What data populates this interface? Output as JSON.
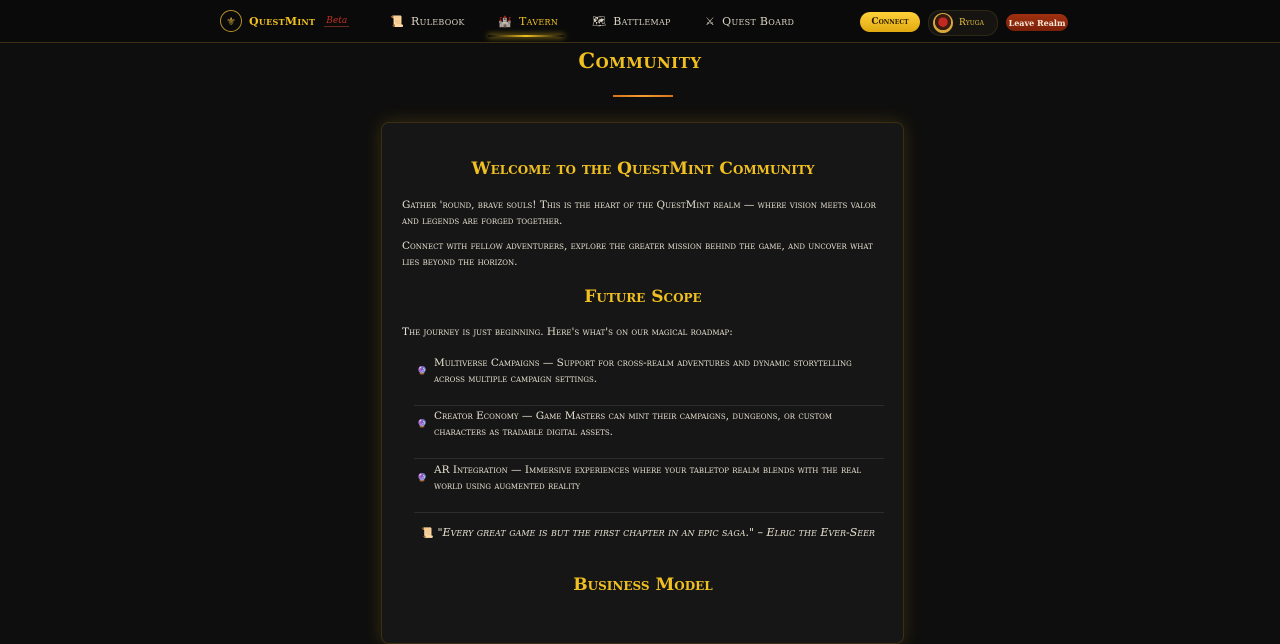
{
  "nav": {
    "brand": "QuestMint",
    "badge": "Beta",
    "items": [
      {
        "icon": "scroll-icon",
        "glyph": "📜",
        "label": "Rulebook"
      },
      {
        "icon": "castle-icon",
        "glyph": "🏰",
        "label": "Tavern"
      },
      {
        "icon": "map-icon",
        "glyph": "🗺",
        "label": "Battlemap"
      },
      {
        "icon": "crossed-swords-icon",
        "glyph": "⚔",
        "label": "Quest Board"
      }
    ],
    "active_item": "Tavern",
    "connect_label": "Connect",
    "user_name": "Ryuga",
    "leave_label": "Leave Realm"
  },
  "page": {
    "title": "Community",
    "card": {
      "welcome_heading": "Welcome to the QuestMint Community",
      "welcome_p1": "Gather 'round, brave souls! This is the heart of the QuestMint realm — where vision meets valor and legends are forged together.",
      "welcome_p2": "Connect with fellow adventurers, explore the greater mission behind the game, and uncover what lies beyond the horizon.",
      "future_heading": "Future Scope",
      "future_intro": "The journey is just beginning. Here's what's on our magical roadmap:",
      "roadmap": [
        {
          "icon": "crystal-ball-icon",
          "text": "Multiverse Campaigns — Support for cross-realm adventures and dynamic storytelling across multiple campaign settings."
        },
        {
          "icon": "crystal-ball-icon",
          "text": "Creator Economy — Game Masters can mint their campaigns, dungeons, or custom characters as tradable digital assets."
        },
        {
          "icon": "crystal-ball-icon",
          "text": "AR Integration — Immersive experiences where your tabletop realm blends with the real world using augmented reality"
        }
      ],
      "quote": "\"Every great game is but the first chapter in an epic saga.\" – Elric the Ever-Seer",
      "business_heading": "Business Model"
    }
  },
  "colors": {
    "accent": "#f0c020",
    "background": "#0e0e0e",
    "card": "#161616",
    "leave": "#8a2810"
  }
}
